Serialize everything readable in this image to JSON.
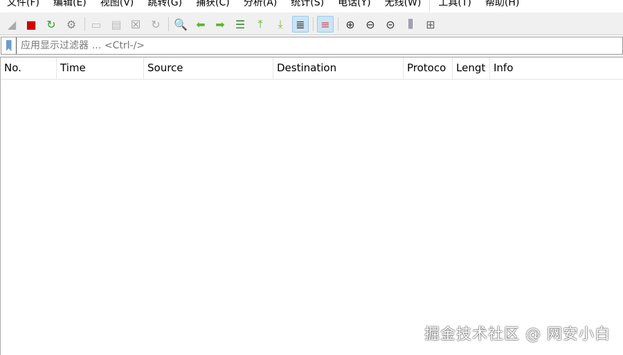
{
  "menu": [
    "文件(F)",
    "编辑(E)",
    "视图(V)",
    "跳转(G)",
    "捕获(C)",
    "分析(A)",
    "统计(S)",
    "电话(Y)",
    "无线(W)",
    "工具(T)",
    "帮助(H)"
  ],
  "toolbar": [
    {
      "icon": "shark-fin-start-icon",
      "glyph": "◢",
      "color": "#aaa"
    },
    {
      "icon": "stop-capture-icon",
      "glyph": "■",
      "color": "#d00000"
    },
    {
      "icon": "restart-capture-icon",
      "glyph": "↻",
      "color": "#2aa52a"
    },
    {
      "icon": "capture-options-gear-icon",
      "glyph": "⚙",
      "color": "#888"
    },
    {
      "icon": "open-file-icon",
      "glyph": "▭",
      "color": "#bbb"
    },
    {
      "icon": "save-file-icon",
      "glyph": "▤",
      "color": "#bbb"
    },
    {
      "icon": "close-file-icon",
      "glyph": "☒",
      "color": "#999"
    },
    {
      "icon": "reload-file-icon",
      "glyph": "↻",
      "color": "#aaa"
    },
    {
      "icon": "find-packet-icon",
      "glyph": "🔍",
      "color": "#000"
    },
    {
      "icon": "go-back-icon",
      "glyph": "⬅",
      "color": "#5cb82a"
    },
    {
      "icon": "go-forward-icon",
      "glyph": "➡",
      "color": "#5cb82a"
    },
    {
      "icon": "go-to-packet-icon",
      "glyph": "☰",
      "color": "#3a8a2a"
    },
    {
      "icon": "first-packet-icon",
      "glyph": "⤒",
      "color": "#5cb82a"
    },
    {
      "icon": "last-packet-icon",
      "glyph": "⤓",
      "color": "#8ab84a"
    },
    {
      "icon": "autoscroll-icon",
      "glyph": "≣",
      "color": "#333"
    },
    {
      "icon": "colorize-icon",
      "glyph": "≡",
      "color": "#c44"
    },
    {
      "icon": "zoom-in-icon",
      "glyph": "⊕",
      "color": "#333"
    },
    {
      "icon": "zoom-out-icon",
      "glyph": "⊖",
      "color": "#333"
    },
    {
      "icon": "zoom-normal-icon",
      "glyph": "⊝",
      "color": "#333"
    },
    {
      "icon": "resize-columns-icon",
      "glyph": "⫼",
      "color": "#446"
    },
    {
      "icon": "layout-panes-icon",
      "glyph": "⊞",
      "color": "#666"
    }
  ],
  "filter": {
    "placeholder": "应用显示过滤器 … <Ctrl-/>"
  },
  "columns": [
    "No.",
    "Time",
    "Source",
    "Destination",
    "Protoco",
    "Lengt",
    "Info"
  ],
  "watermark": "掘金技术社区 @ 网安小白"
}
